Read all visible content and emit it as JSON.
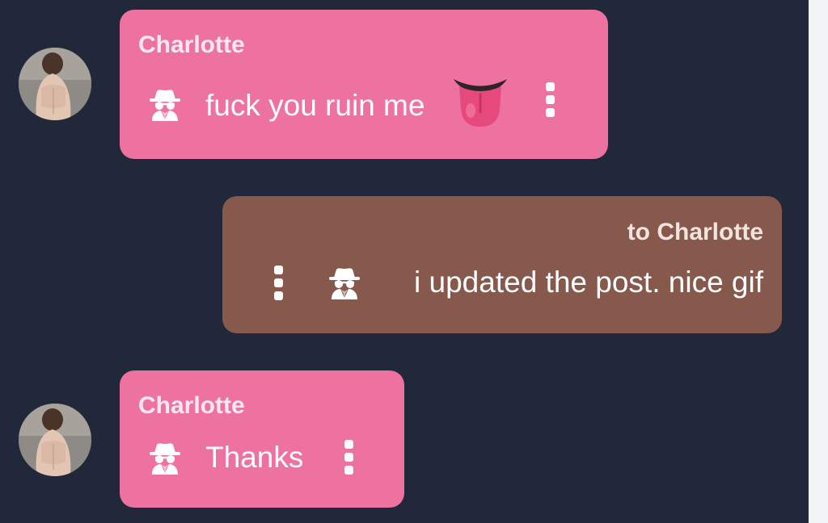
{
  "messages": [
    {
      "direction": "incoming",
      "sender": "Charlotte",
      "text": "fuck you ruin me",
      "emoji": "tongue-emoji"
    },
    {
      "direction": "outgoing",
      "sender": "to Charlotte",
      "text": "i updated the post. nice gif"
    },
    {
      "direction": "incoming",
      "sender": "Charlotte",
      "text": "Thanks"
    }
  ],
  "icons": {
    "anonymous": "spy-icon",
    "options": "more-vertical-icon",
    "avatar": "avatar"
  },
  "colors": {
    "background": "#20283a",
    "incoming_bubble": "#ee729f",
    "outgoing_bubble": "#87594c",
    "text": "#ffffff"
  }
}
